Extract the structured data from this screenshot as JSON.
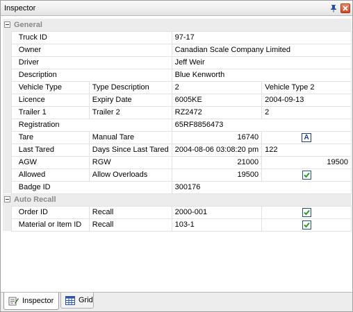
{
  "window": {
    "title": "Inspector"
  },
  "colors": {
    "check": "#2a9a2a",
    "close_button": "#d4441c",
    "pin": "#1f4fa8"
  },
  "categories": [
    {
      "name": "General",
      "rows": [
        {
          "label": "Truck ID",
          "value": "97-17"
        },
        {
          "label": "Owner",
          "value": "Canadian Scale Company Limited"
        },
        {
          "label": "Driver",
          "value": "Jeff Weir"
        },
        {
          "label": "Description",
          "value": "Blue Kenworth"
        },
        {
          "label": "Vehicle Type",
          "sublabel": "Type Description",
          "value": "2",
          "value2": "Vehicle Type 2"
        },
        {
          "label": "Licence",
          "sublabel": "Expiry Date",
          "value": "6005KE",
          "value2": "2004-09-13"
        },
        {
          "label": "Trailer 1",
          "sublabel": "Trailer 2",
          "value": "RZ2472",
          "value2": "2"
        },
        {
          "label": "Registration",
          "value": "65RF8856473"
        },
        {
          "label": "Tare",
          "sublabel": "Manual Tare",
          "value": "16740",
          "value2_glyph": "A"
        },
        {
          "label": "Last Tared",
          "sublabel": "Days Since Last Tared",
          "value": "2004-08-06 03:08:20 pm",
          "value2": "122"
        },
        {
          "label": "AGW",
          "sublabel": "RGW",
          "value": "21000",
          "value2": "19500"
        },
        {
          "label": "Allowed",
          "sublabel": "Allow Overloads",
          "value": "19500",
          "value2_checked": true
        },
        {
          "label": "Badge ID",
          "value": "300176"
        }
      ]
    },
    {
      "name": "Auto Recall",
      "rows": [
        {
          "label": "Order ID",
          "sublabel": "Recall",
          "value": "2000-001",
          "value2_checked": true
        },
        {
          "label": "Material or Item ID",
          "sublabel": "Recall",
          "value": "103-1",
          "value2_checked": true
        }
      ]
    }
  ],
  "tabs": [
    {
      "label": "Inspector",
      "icon": "inspector-icon",
      "active": true
    },
    {
      "label": "Grid",
      "icon": "grid-icon",
      "active": false
    }
  ]
}
